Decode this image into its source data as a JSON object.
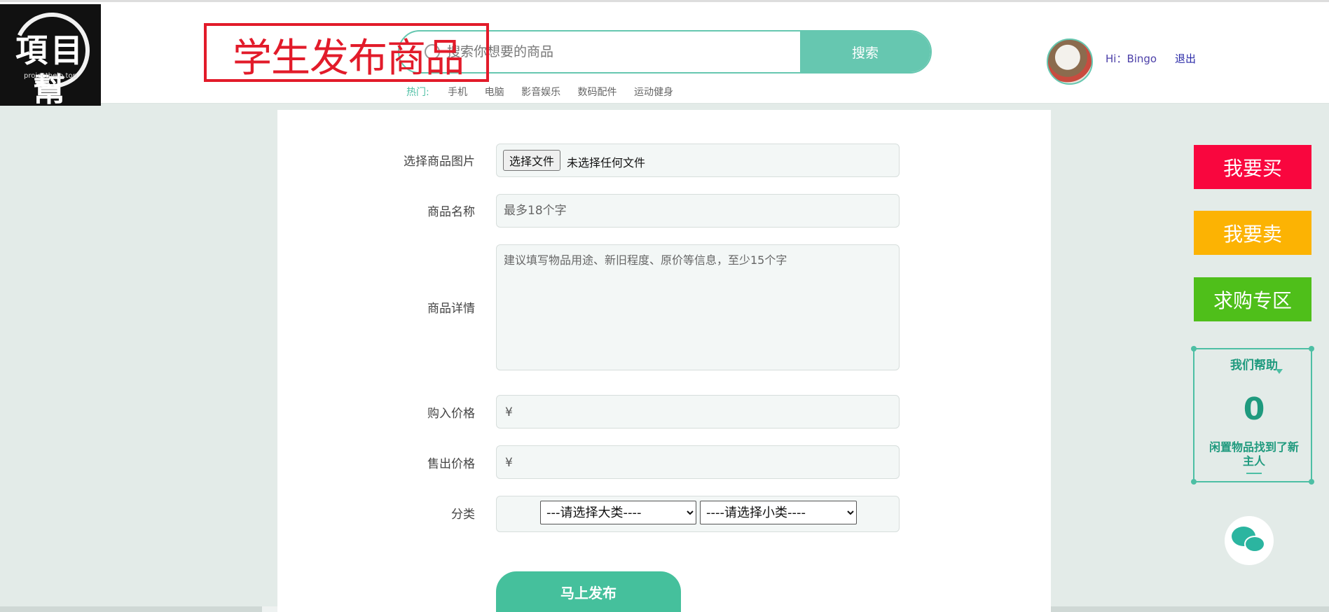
{
  "logo": {
    "chars": "項目幫",
    "url": "projecthelp.top"
  },
  "banner": {
    "text": "学生发布商品"
  },
  "search": {
    "placeholder": "搜索你想要的商品",
    "button": "搜索"
  },
  "hot": {
    "label": "热门:",
    "keywords": [
      "手机",
      "电脑",
      "影音娱乐",
      "数码配件",
      "运动健身"
    ]
  },
  "user": {
    "greeting": "Hi：Bingo",
    "logout": "退出"
  },
  "form": {
    "image_label": "选择商品图片",
    "file_button": "选择文件",
    "file_status": "未选择任何文件",
    "name_label": "商品名称",
    "name_placeholder": "最多18个字",
    "detail_label": "商品详情",
    "detail_placeholder": "建议填写物品用途、新旧程度、原价等信息，至少15个字",
    "buy_price_label": "购入价格",
    "sell_price_label": "售出价格",
    "currency": "¥",
    "category_label": "分类",
    "category_major": "---请选择大类----",
    "category_minor": "----请选择小类----",
    "submit": "马上发布"
  },
  "sidebar": {
    "buy": "我要买",
    "sell": "我要卖",
    "wanted": "求购专区",
    "buy_color": "#f9063e",
    "sell_color": "#fcb303",
    "wanted_color": "#4fbf1a",
    "counter_title": "我们帮助",
    "counter_value": "0",
    "counter_sub": "闲置物品找到了新主人"
  }
}
